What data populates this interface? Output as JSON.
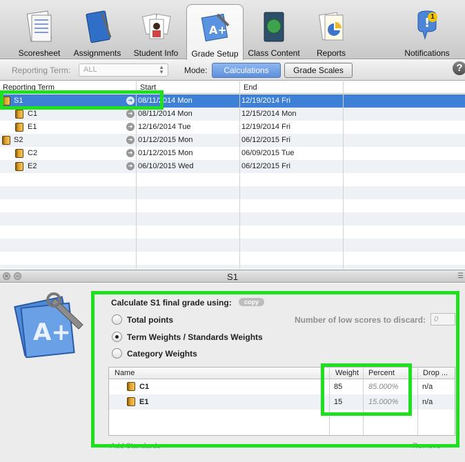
{
  "toolbar": {
    "tabs": [
      {
        "label": "Scoresheet",
        "icon": "scoresheet-icon"
      },
      {
        "label": "Assignments",
        "icon": "notebook-icon"
      },
      {
        "label": "Student Info",
        "icon": "student-photos-icon"
      },
      {
        "label": "Grade Setup",
        "icon": "grade-setup-icon",
        "active": true
      },
      {
        "label": "Class Content",
        "icon": "book-globe-icon"
      },
      {
        "label": "Reports",
        "icon": "reports-icon"
      },
      {
        "label": "Notifications",
        "icon": "notifications-icon"
      }
    ],
    "notification_count": "1"
  },
  "modebar": {
    "reporting_term_label": "Reporting Term:",
    "reporting_term_value": "ALL",
    "mode_label": "Mode:",
    "calculations_label": "Calculations",
    "grade_scales_label": "Grade Scales",
    "help_label": "?"
  },
  "grid": {
    "headers": {
      "term": "Reporting Term",
      "start": "Start",
      "end": "End"
    },
    "rows": [
      {
        "name": "S1",
        "start": "08/11/2014 Mon",
        "end": "12/19/2014 Fri"
      },
      {
        "name": "C1",
        "start": "08/11/2014 Mon",
        "end": "12/15/2014 Mon"
      },
      {
        "name": "E1",
        "start": "12/16/2014 Tue",
        "end": "12/19/2014 Fri"
      },
      {
        "name": "S2",
        "start": "01/12/2015 Mon",
        "end": "06/12/2015 Fri"
      },
      {
        "name": "C2",
        "start": "01/12/2015 Mon",
        "end": "06/09/2015 Tue"
      },
      {
        "name": "E2",
        "start": "06/10/2015 Wed",
        "end": "06/12/2015 Fri"
      }
    ]
  },
  "inspector": {
    "title": "S1",
    "calc_title": "Calculate S1 final grade using:",
    "copy_label": "copy",
    "options": {
      "total_points": "Total points",
      "term_weights": "Term Weights / Standards Weights",
      "category_weights": "Category Weights"
    },
    "low_scores_label": "Number of low scores to discard:",
    "low_scores_value": "0",
    "table": {
      "headers": {
        "name": "Name",
        "weight": "Weight",
        "percent": "Percent",
        "drop": "Drop ..."
      },
      "rows": [
        {
          "name": "C1",
          "weight": "85",
          "percent": "85.000%",
          "drop": "n/a"
        },
        {
          "name": "E1",
          "weight": "15",
          "percent": "15.000%",
          "drop": "n/a"
        }
      ]
    },
    "add_standards": "Add Standards",
    "remove": "Remove"
  },
  "colors": {
    "selection": "#3d80d6",
    "highlight": "#1fe01f",
    "mode_active": "#5d8fdc"
  }
}
